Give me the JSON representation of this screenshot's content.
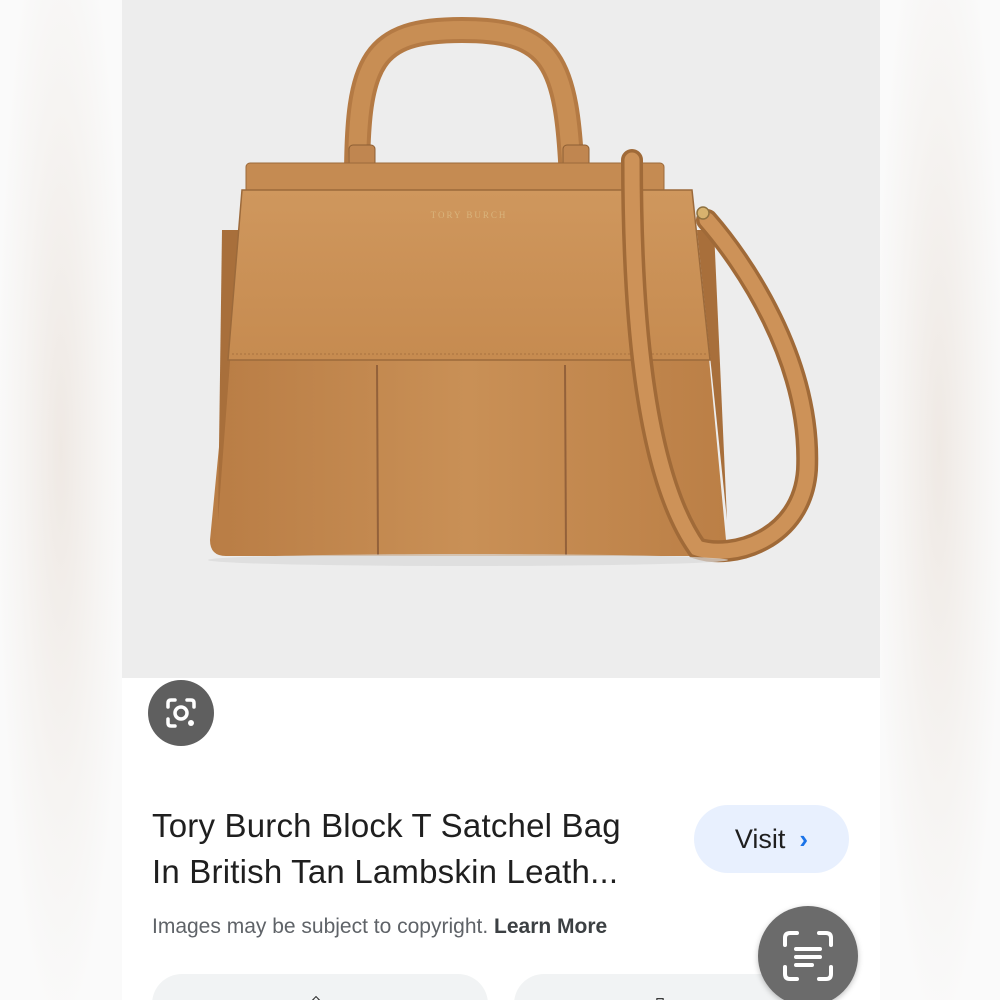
{
  "product": {
    "title_line1": "Tory Burch Block T Satchel Bag",
    "title_line2": "In British Tan Lambskin Leath...",
    "brand_stamp": "TORY BURCH"
  },
  "actions": {
    "visit_label": "Visit",
    "visit_chevron": "›"
  },
  "notice": {
    "text": "Images may be subject to copyright.",
    "link": "Learn More"
  },
  "colors": {
    "accent_blue": "#1a73e8",
    "visit_bg": "#e8f0fe",
    "bag_tan": "#c58a4e",
    "image_bg": "#ededed"
  },
  "icons": {
    "lens": "lens-search-icon",
    "text_scan": "text-scan-icon"
  }
}
